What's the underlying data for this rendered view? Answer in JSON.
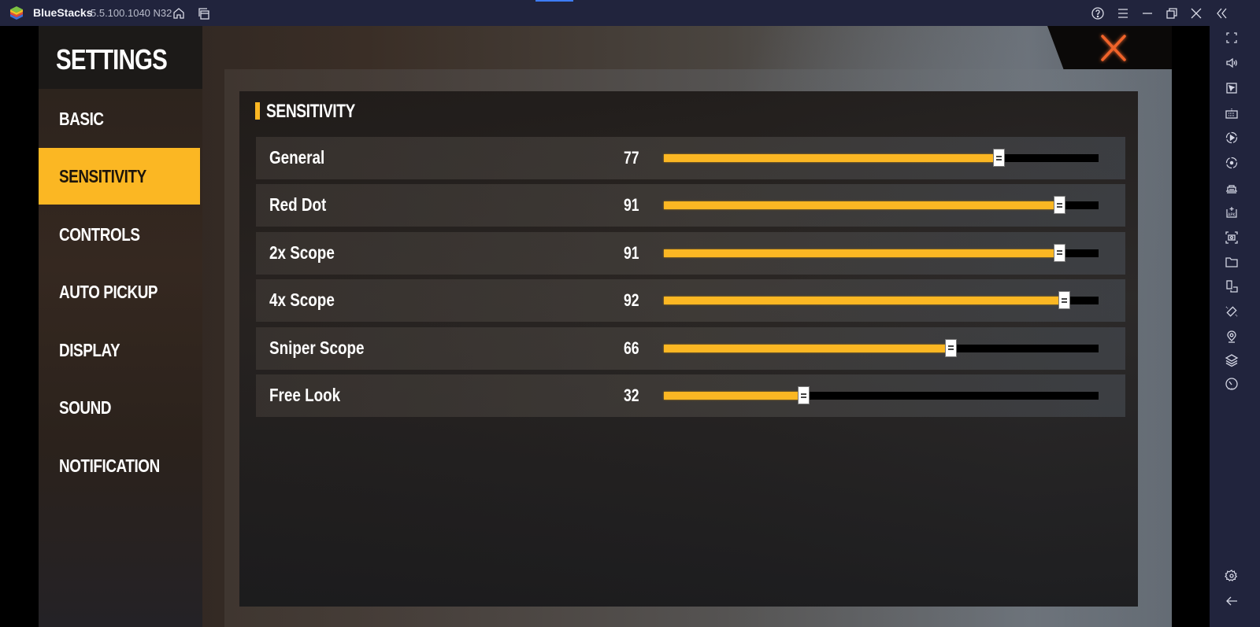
{
  "window": {
    "app_name": "BlueStacks",
    "version": "5.5.100.1040 N32",
    "accent_color": "#3d7cf5",
    "titlebar_icons": [
      "home-icon",
      "multi-instance-icon",
      "help-icon",
      "menu-icon",
      "minimize-icon",
      "restore-icon",
      "close-icon",
      "collapse-sidebar-icon"
    ]
  },
  "sidebar_tools": [
    {
      "name": "fullscreen-icon"
    },
    {
      "name": "volume-icon"
    },
    {
      "name": "pointer-icon"
    },
    {
      "name": "keyboard-icon"
    },
    {
      "name": "macro-record-icon"
    },
    {
      "name": "record-icon"
    },
    {
      "name": "game-controls-icon"
    },
    {
      "name": "install-apk-icon"
    },
    {
      "name": "screenshot-icon"
    },
    {
      "name": "folder-icon"
    },
    {
      "name": "multi-window-icon"
    },
    {
      "name": "rotate-icon"
    },
    {
      "name": "location-icon"
    },
    {
      "name": "layers-icon"
    },
    {
      "name": "eco-mode-icon"
    },
    {
      "name": "settings-icon"
    },
    {
      "name": "back-icon"
    }
  ],
  "settings": {
    "title": "SETTINGS",
    "highlight_color": "#fbb723",
    "nav": [
      {
        "label": "BASIC",
        "active": false
      },
      {
        "label": "SENSITIVITY",
        "active": true
      },
      {
        "label": "CONTROLS",
        "active": false
      },
      {
        "label": "AUTO PICKUP",
        "active": false
      },
      {
        "label": "DISPLAY",
        "active": false
      },
      {
        "label": "SOUND",
        "active": false
      },
      {
        "label": "NOTIFICATION",
        "active": false
      }
    ],
    "close_color": "#f0642a"
  },
  "sensitivity": {
    "section_title": "SENSITIVITY",
    "slider_max": 100,
    "rows": [
      {
        "label": "General",
        "value": 77
      },
      {
        "label": "Red Dot",
        "value": 91
      },
      {
        "label": "2x Scope",
        "value": 91
      },
      {
        "label": "4x Scope",
        "value": 92
      },
      {
        "label": "Sniper Scope",
        "value": 66
      },
      {
        "label": "Free Look",
        "value": 32
      }
    ]
  }
}
